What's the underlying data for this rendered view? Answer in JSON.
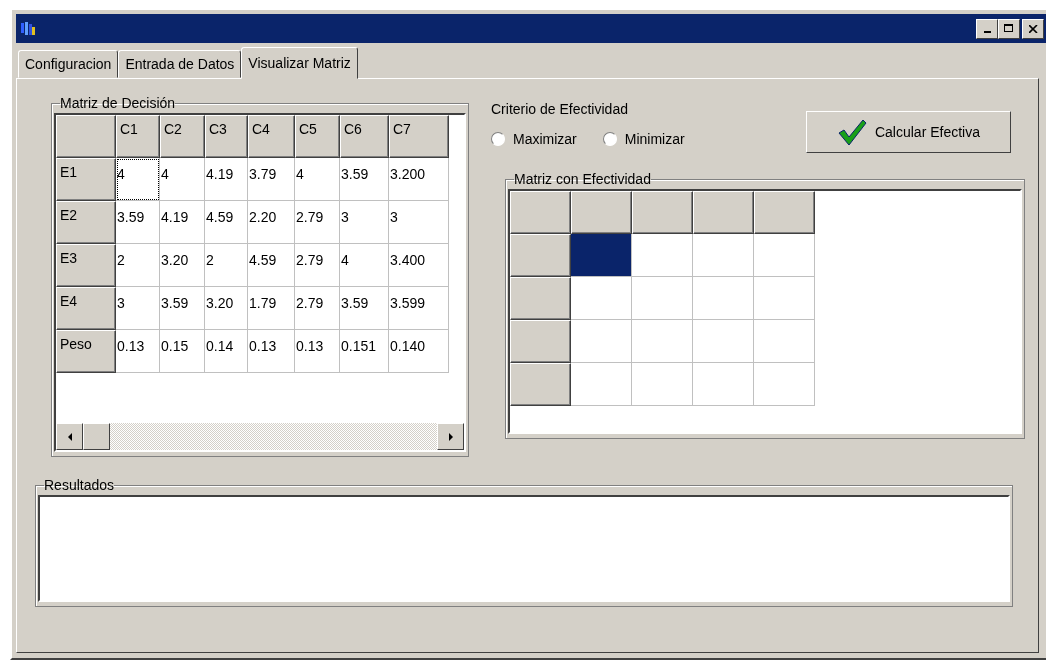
{
  "window": {
    "controls": [
      {
        "kind": "minimize"
      },
      {
        "kind": "maximize"
      },
      {
        "kind": "close"
      }
    ]
  },
  "tabs": [
    {
      "label": "Configuracion",
      "selected": false
    },
    {
      "label": "Entrada de Datos",
      "selected": false
    },
    {
      "label": "Visualizar Matriz",
      "selected": true
    }
  ],
  "decision_matrix": {
    "title": "Matriz de Decisión",
    "columns": [
      "C1",
      "C2",
      "C3",
      "C4",
      "C5",
      "C6",
      "C7"
    ],
    "rows": [
      {
        "label": "E1",
        "cells": [
          {
            "text": "4",
            "focused": true
          },
          {
            "text": "4",
            "focused": false
          },
          {
            "text": "4.19",
            "focused": false
          },
          {
            "text": "3.79",
            "focused": false
          },
          {
            "text": "4",
            "focused": false
          },
          {
            "text": "3.59",
            "focused": false
          },
          {
            "text": "3.200",
            "focused": false
          }
        ]
      },
      {
        "label": "E2",
        "cells": [
          {
            "text": "3.59",
            "focused": false
          },
          {
            "text": "4.19",
            "focused": false
          },
          {
            "text": "4.59",
            "focused": false
          },
          {
            "text": "2.20",
            "focused": false
          },
          {
            "text": "2.79",
            "focused": false
          },
          {
            "text": "3",
            "focused": false
          },
          {
            "text": "3",
            "focused": false
          }
        ]
      },
      {
        "label": "E3",
        "cells": [
          {
            "text": "2",
            "focused": false
          },
          {
            "text": "3.20",
            "focused": false
          },
          {
            "text": "2",
            "focused": false
          },
          {
            "text": "4.59",
            "focused": false
          },
          {
            "text": "2.79",
            "focused": false
          },
          {
            "text": "4",
            "focused": false
          },
          {
            "text": "3.400",
            "focused": false
          }
        ]
      },
      {
        "label": "E4",
        "cells": [
          {
            "text": "3",
            "focused": false
          },
          {
            "text": "3.59",
            "focused": false
          },
          {
            "text": "3.20",
            "focused": false
          },
          {
            "text": "1.79",
            "focused": false
          },
          {
            "text": "2.79",
            "focused": false
          },
          {
            "text": "3.59",
            "focused": false
          },
          {
            "text": "3.599",
            "focused": false
          }
        ]
      },
      {
        "label": "Peso",
        "cells": [
          {
            "text": "0.13",
            "focused": false
          },
          {
            "text": "0.15",
            "focused": false
          },
          {
            "text": "0.14",
            "focused": false
          },
          {
            "text": "0.13",
            "focused": false
          },
          {
            "text": "0.13",
            "focused": false
          },
          {
            "text": "0.151",
            "focused": false
          },
          {
            "text": "0.140",
            "focused": false
          }
        ]
      }
    ]
  },
  "criterion": {
    "title": "Criterio de Efectividad",
    "options": [
      {
        "label": "Maximizar",
        "selected": false
      },
      {
        "label": "Minimizar",
        "selected": false
      }
    ]
  },
  "calculate_button": {
    "label": "Calcular Efectiva"
  },
  "effectivity_matrix": {
    "title": "Matriz con Efectividad",
    "rows": [
      {
        "cells": [
          {
            "selected": true
          },
          {
            "selected": false
          },
          {
            "selected": false
          },
          {
            "selected": false
          }
        ]
      },
      {
        "cells": [
          {
            "selected": false
          },
          {
            "selected": false
          },
          {
            "selected": false
          },
          {
            "selected": false
          }
        ]
      },
      {
        "cells": [
          {
            "selected": false
          },
          {
            "selected": false
          },
          {
            "selected": false
          },
          {
            "selected": false
          }
        ]
      },
      {
        "cells": [
          {
            "selected": false
          },
          {
            "selected": false
          },
          {
            "selected": false
          },
          {
            "selected": false
          }
        ]
      }
    ]
  },
  "results": {
    "title": "Resultados"
  }
}
